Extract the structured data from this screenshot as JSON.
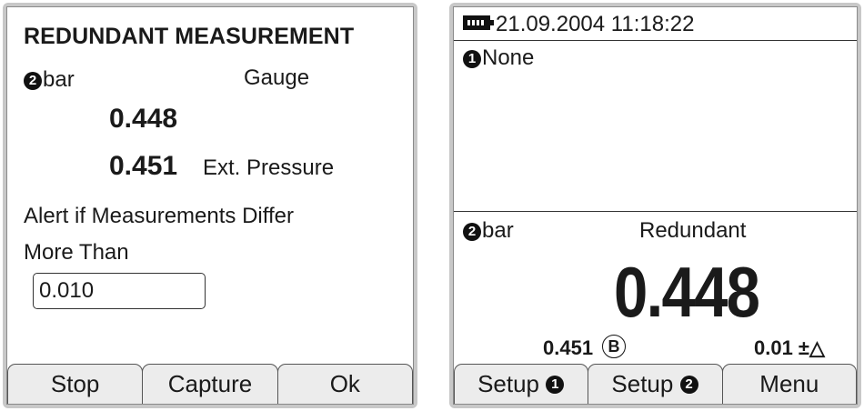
{
  "left_screen": {
    "title": "REDUNDANT MEASUREMENT",
    "channel_badge": "2",
    "unit": "bar",
    "mode": "Gauge",
    "primary_value": "0.448",
    "secondary_value": "0.451",
    "secondary_label": "Ext. Pressure",
    "alert_line1": "Alert if Measurements Differ",
    "alert_line2": "More Than",
    "threshold_value": "0.010",
    "softkeys": [
      "Stop",
      "Capture",
      "Ok"
    ]
  },
  "right_screen": {
    "battery_icon": "battery-icon",
    "datetime": "21.09.2004  11:18:22",
    "channel1_badge": "1",
    "channel1_label": "None",
    "channel2_badge": "2",
    "channel2_unit": "bar",
    "channel2_mode": "Redundant",
    "main_value": "0.448",
    "secondary_value": "0.451",
    "secondary_marker": "B",
    "tolerance": "0.01 ±△",
    "softkeys": {
      "setup1_label": "Setup",
      "setup1_badge": "1",
      "setup2_label": "Setup",
      "setup2_badge": "2",
      "menu_label": "Menu"
    }
  }
}
